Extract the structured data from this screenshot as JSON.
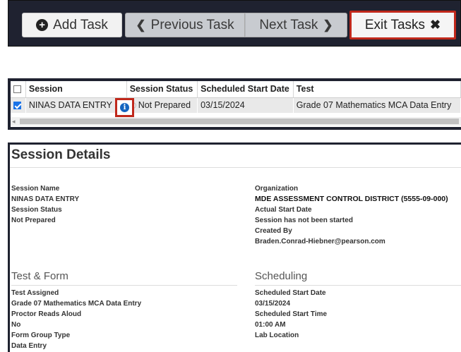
{
  "toolbar": {
    "add_task": "Add Task",
    "previous_task": "Previous Task",
    "next_task": "Next Task",
    "exit_tasks": "Exit Tasks"
  },
  "session_table": {
    "columns": [
      "Session",
      "Session Status",
      "Scheduled Start Date",
      "Test"
    ],
    "row": {
      "session": "NINAS DATA ENTRY",
      "status": "Not Prepared",
      "scheduled_start_date": "03/15/2024",
      "test": "Grade 07 Mathematics MCA Data Entry",
      "checked": true
    }
  },
  "details": {
    "title": "Session Details",
    "left": [
      {
        "label": "Session Name",
        "value": "NINAS DATA ENTRY"
      },
      {
        "label": "Session Status",
        "value": "Not Prepared"
      }
    ],
    "right": {
      "organization_label": "Organization",
      "organization_value": "MDE ASSESSMENT CONTROL DISTRICT (5555-09-000)",
      "actual_start_label": "Actual Start Date",
      "actual_start_value": "Session has not been started",
      "created_by_label": "Created By",
      "created_by_value": "Braden.Conrad-Hiebner@pearson.com"
    },
    "test_form": {
      "heading": "Test & Form",
      "test_assigned_label": "Test Assigned",
      "test_assigned_value": "Grade 07 Mathematics MCA Data Entry",
      "proctor_label": "Proctor Reads Aloud",
      "proctor_value": "No",
      "form_group_label": "Form Group Type",
      "form_group_value": "Data Entry"
    },
    "scheduling": {
      "heading": "Scheduling",
      "start_date_label": "Scheduled Start Date",
      "start_date_value": "03/15/2024",
      "start_time_label": "Scheduled Start Time",
      "start_time_value": "01:00 AM",
      "lab_label": "Lab Location"
    }
  },
  "colors": {
    "highlight_red": "#c0281b",
    "toolbar_bg": "#1f2230",
    "info_blue": "#1565c0"
  }
}
